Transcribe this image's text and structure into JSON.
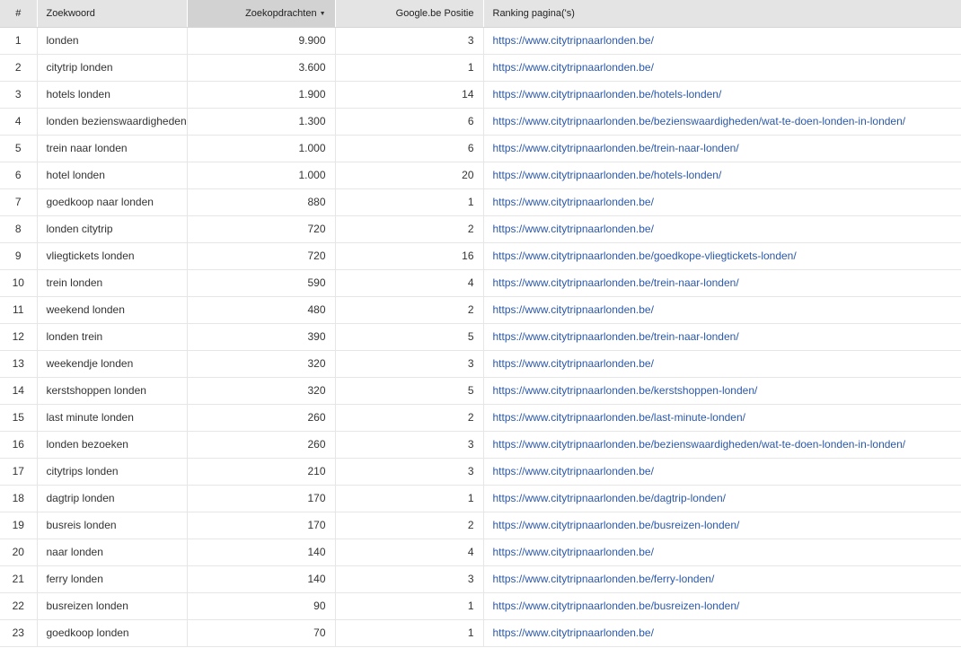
{
  "table": {
    "headers": {
      "num": "#",
      "keyword": "Zoekwoord",
      "volume": "Zoekopdrachten",
      "position": "Google.be Positie",
      "url": "Ranking pagina('s)"
    },
    "sort_column": "volume",
    "sort_direction": "descending",
    "rows": [
      {
        "num": "1",
        "keyword": "londen",
        "volume": "9.900",
        "position": "3",
        "url": "https://www.citytripnaarlonden.be/"
      },
      {
        "num": "2",
        "keyword": "citytrip londen",
        "volume": "3.600",
        "position": "1",
        "url": "https://www.citytripnaarlonden.be/"
      },
      {
        "num": "3",
        "keyword": "hotels londen",
        "volume": "1.900",
        "position": "14",
        "url": "https://www.citytripnaarlonden.be/hotels-londen/"
      },
      {
        "num": "4",
        "keyword": "londen bezienswaardigheden",
        "volume": "1.300",
        "position": "6",
        "url": "https://www.citytripnaarlonden.be/bezienswaardigheden/wat-te-doen-londen-in-londen/"
      },
      {
        "num": "5",
        "keyword": "trein naar londen",
        "volume": "1.000",
        "position": "6",
        "url": "https://www.citytripnaarlonden.be/trein-naar-londen/"
      },
      {
        "num": "6",
        "keyword": "hotel londen",
        "volume": "1.000",
        "position": "20",
        "url": "https://www.citytripnaarlonden.be/hotels-londen/"
      },
      {
        "num": "7",
        "keyword": "goedkoop naar londen",
        "volume": "880",
        "position": "1",
        "url": "https://www.citytripnaarlonden.be/"
      },
      {
        "num": "8",
        "keyword": "londen citytrip",
        "volume": "720",
        "position": "2",
        "url": "https://www.citytripnaarlonden.be/"
      },
      {
        "num": "9",
        "keyword": "vliegtickets londen",
        "volume": "720",
        "position": "16",
        "url": "https://www.citytripnaarlonden.be/goedkope-vliegtickets-londen/"
      },
      {
        "num": "10",
        "keyword": "trein londen",
        "volume": "590",
        "position": "4",
        "url": "https://www.citytripnaarlonden.be/trein-naar-londen/"
      },
      {
        "num": "11",
        "keyword": "weekend londen",
        "volume": "480",
        "position": "2",
        "url": "https://www.citytripnaarlonden.be/"
      },
      {
        "num": "12",
        "keyword": "londen trein",
        "volume": "390",
        "position": "5",
        "url": "https://www.citytripnaarlonden.be/trein-naar-londen/"
      },
      {
        "num": "13",
        "keyword": "weekendje londen",
        "volume": "320",
        "position": "3",
        "url": "https://www.citytripnaarlonden.be/"
      },
      {
        "num": "14",
        "keyword": "kerstshoppen londen",
        "volume": "320",
        "position": "5",
        "url": "https://www.citytripnaarlonden.be/kerstshoppen-londen/"
      },
      {
        "num": "15",
        "keyword": "last minute londen",
        "volume": "260",
        "position": "2",
        "url": "https://www.citytripnaarlonden.be/last-minute-londen/"
      },
      {
        "num": "16",
        "keyword": "londen bezoeken",
        "volume": "260",
        "position": "3",
        "url": "https://www.citytripnaarlonden.be/bezienswaardigheden/wat-te-doen-londen-in-londen/"
      },
      {
        "num": "17",
        "keyword": "citytrips londen",
        "volume": "210",
        "position": "3",
        "url": "https://www.citytripnaarlonden.be/"
      },
      {
        "num": "18",
        "keyword": "dagtrip londen",
        "volume": "170",
        "position": "1",
        "url": "https://www.citytripnaarlonden.be/dagtrip-londen/"
      },
      {
        "num": "19",
        "keyword": "busreis londen",
        "volume": "170",
        "position": "2",
        "url": "https://www.citytripnaarlonden.be/busreizen-londen/"
      },
      {
        "num": "20",
        "keyword": "naar londen",
        "volume": "140",
        "position": "4",
        "url": "https://www.citytripnaarlonden.be/"
      },
      {
        "num": "21",
        "keyword": "ferry londen",
        "volume": "140",
        "position": "3",
        "url": "https://www.citytripnaarlonden.be/ferry-londen/"
      },
      {
        "num": "22",
        "keyword": "busreizen londen",
        "volume": "90",
        "position": "1",
        "url": "https://www.citytripnaarlonden.be/busreizen-londen/"
      },
      {
        "num": "23",
        "keyword": "goedkoop londen",
        "volume": "70",
        "position": "1",
        "url": "https://www.citytripnaarlonden.be/"
      }
    ]
  }
}
